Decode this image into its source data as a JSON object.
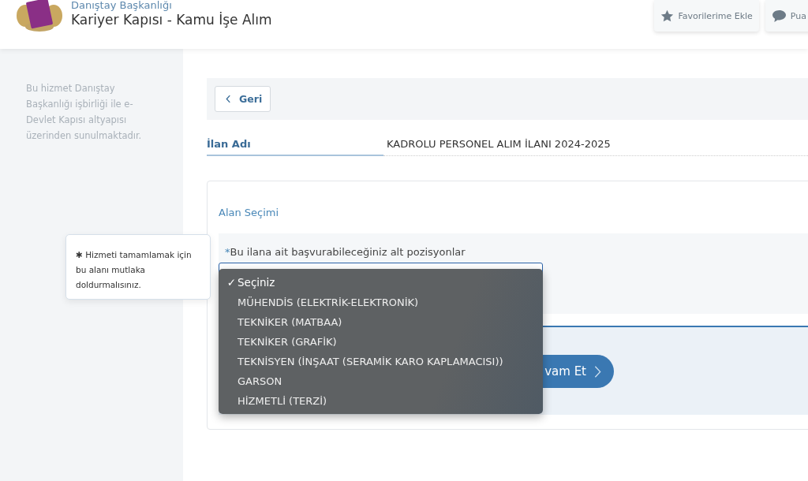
{
  "header": {
    "organization": "Danıştay Başkanlığı",
    "title": "Kariyer Kapısı - Kamu İşe Alım",
    "actions": [
      {
        "label": "Favorilerime Ekle",
        "kind": "star"
      },
      {
        "label": "Pua",
        "kind": "comment"
      }
    ]
  },
  "sidebar": {
    "text": "Bu hizmet Danıştay Başkanlığı işbirliği ile e-Devlet Kapısı altyapısı üzerinden sunulmaktadır."
  },
  "back_button": {
    "label": "Geri"
  },
  "listing": {
    "label": "İlan Adı",
    "value": "KADROLU PERSONEL ALIM İLANI 2024-2025"
  },
  "section": {
    "title": "Alan Seçimi",
    "field_label": "Bu ilana ait başvurabileceğiniz alt pozisyonlar",
    "required_mark": "*",
    "tooltip": "Hizmeti tamamlamak için bu alanı mutlaka doldurmalısınız.",
    "tooltip_mark": "✱"
  },
  "dropdown": {
    "check_mark": "✓",
    "options": [
      {
        "label": "Seçiniz",
        "selected": true
      },
      {
        "label": "MÜHENDİS (ELEKTRİK-ELEKTRONİK)",
        "selected": false
      },
      {
        "label": "TEKNİKER (MATBAA)",
        "selected": false
      },
      {
        "label": "TEKNİKER (GRAFİK)",
        "selected": false
      },
      {
        "label": "TEKNİSYEN (İNŞAAT (SERAMİK KARO KAPLAMACISI))",
        "selected": false
      },
      {
        "label": "GARSON",
        "selected": false
      },
      {
        "label": "HİZMETLİ (TERZİ)",
        "selected": false
      }
    ]
  },
  "continue_button": {
    "label": "vam Et"
  }
}
